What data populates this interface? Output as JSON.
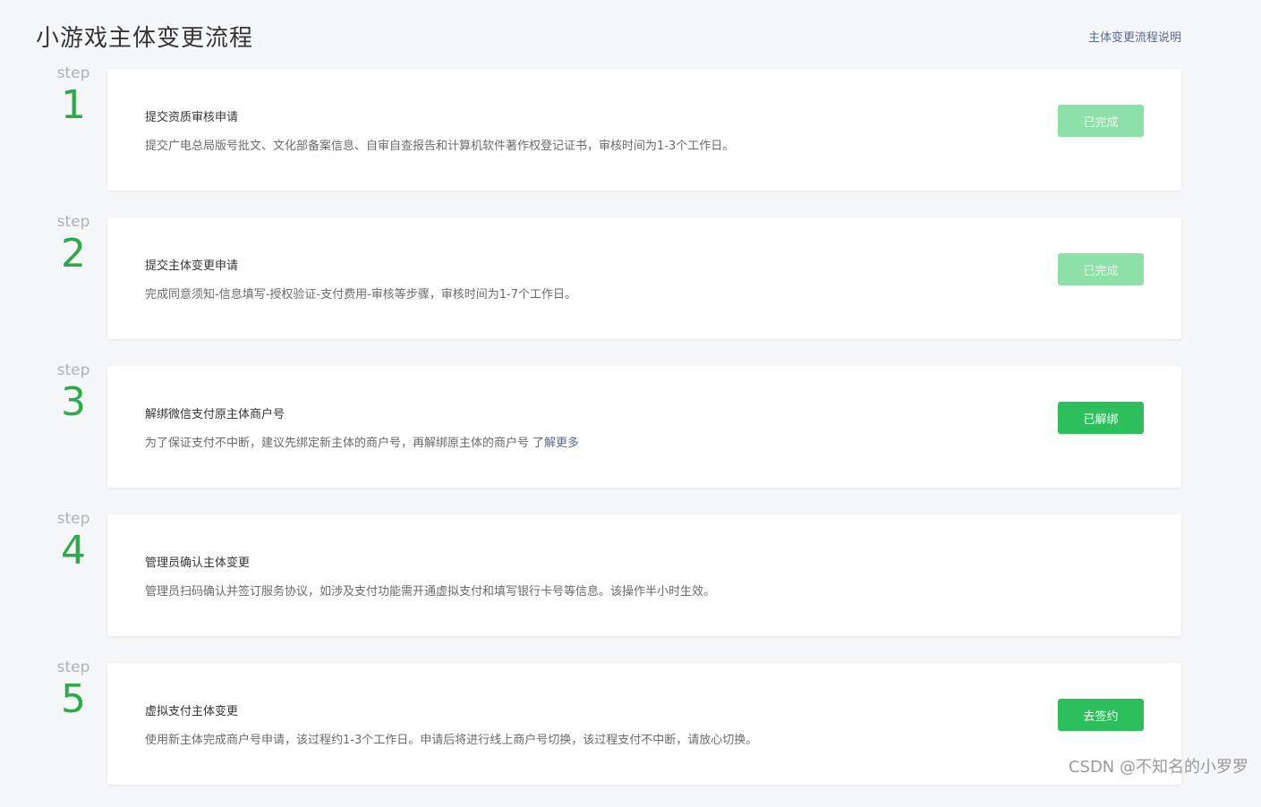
{
  "header": {
    "title": "小游戏主体变更流程",
    "help_link": "主体变更流程说明"
  },
  "steps": [
    {
      "word": "step",
      "number": "1",
      "title": "提交资质审核申请",
      "desc": "提交广电总局版号批文、文化部备案信息、自审自查报告和计算机软件著作权登记证书，审核时间为1-3个工作日。",
      "link": "",
      "button": "已完成",
      "button_state": "disabled"
    },
    {
      "word": "step",
      "number": "2",
      "title": "提交主体变更申请",
      "desc": "完成同意须知-信息填写-授权验证-支付费用-审核等步骤，审核时间为1-7个工作日。",
      "link": "",
      "button": "已完成",
      "button_state": "disabled"
    },
    {
      "word": "step",
      "number": "3",
      "title": "解绑微信支付原主体商户号",
      "desc": "为了保证支付不中断，建议先绑定新主体的商户号，再解绑原主体的商户号",
      "link": "了解更多",
      "button": "已解绑",
      "button_state": "primary"
    },
    {
      "word": "step",
      "number": "4",
      "title": "管理员确认主体变更",
      "desc": "管理员扫码确认并签订服务协议，如涉及支付功能需开通虚拟支付和填写银行卡号等信息。该操作半小时生效。",
      "link": "",
      "button": "",
      "button_state": "none"
    },
    {
      "word": "step",
      "number": "5",
      "title": "虚拟支付主体变更",
      "desc": "使用新主体完成商户号申请，该过程约1-3个工作日。申请后将进行线上商户号切换，该过程支付不中断，请放心切换。",
      "link": "",
      "button": "去签约",
      "button_state": "primary"
    }
  ],
  "watermark": "CSDN @不知名的小罗罗",
  "colors": {
    "accent_green": "#2dbf5b",
    "disabled_green": "#8ee0a9",
    "step_number": "#2cab4a",
    "link": "#576b95"
  }
}
